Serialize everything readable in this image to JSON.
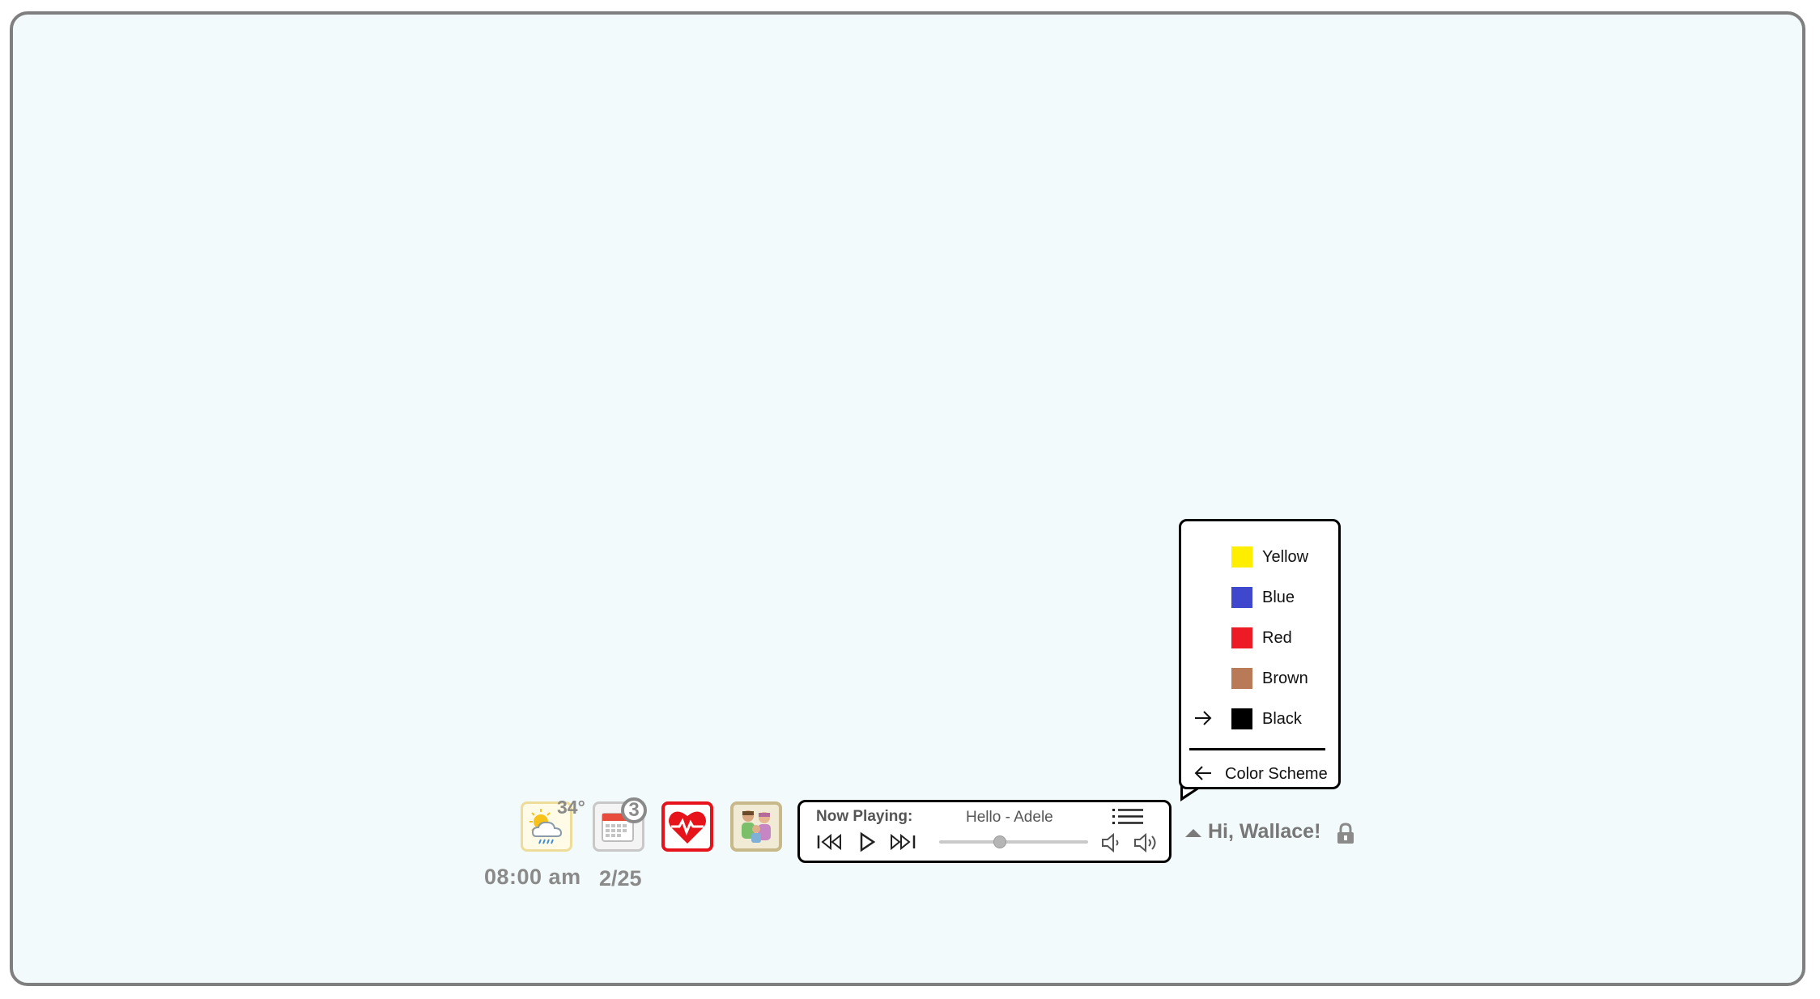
{
  "weather": {
    "temperature": "34°",
    "icon": "weather-sun-rain-icon",
    "time": "08:00 am"
  },
  "calendar": {
    "badge_count": "3",
    "icon": "calendar-icon",
    "date": "2/25"
  },
  "health": {
    "icon": "heartbeat-icon",
    "accent": "#e6131b"
  },
  "family": {
    "icon": "family-icon"
  },
  "player": {
    "now_playing_label": "Now Playing:",
    "track": "Hello - Adele",
    "progress": 0.4,
    "icons": [
      "playlist-icon",
      "previous-track-icon",
      "play-icon",
      "next-track-icon",
      "volume-down-icon",
      "volume-up-icon"
    ]
  },
  "color_scheme_menu": {
    "options": [
      {
        "label": "Yellow",
        "color": "#ffee00",
        "selected": false
      },
      {
        "label": "Blue",
        "color": "#3f48cc",
        "selected": false
      },
      {
        "label": "Red",
        "color": "#ed1c24",
        "selected": false
      },
      {
        "label": "Brown",
        "color": "#b97a57",
        "selected": false
      },
      {
        "label": "Black",
        "color": "#000000",
        "selected": true
      }
    ],
    "back_label": "Color Scheme"
  },
  "user": {
    "greeting": "Hi, Wallace!"
  }
}
